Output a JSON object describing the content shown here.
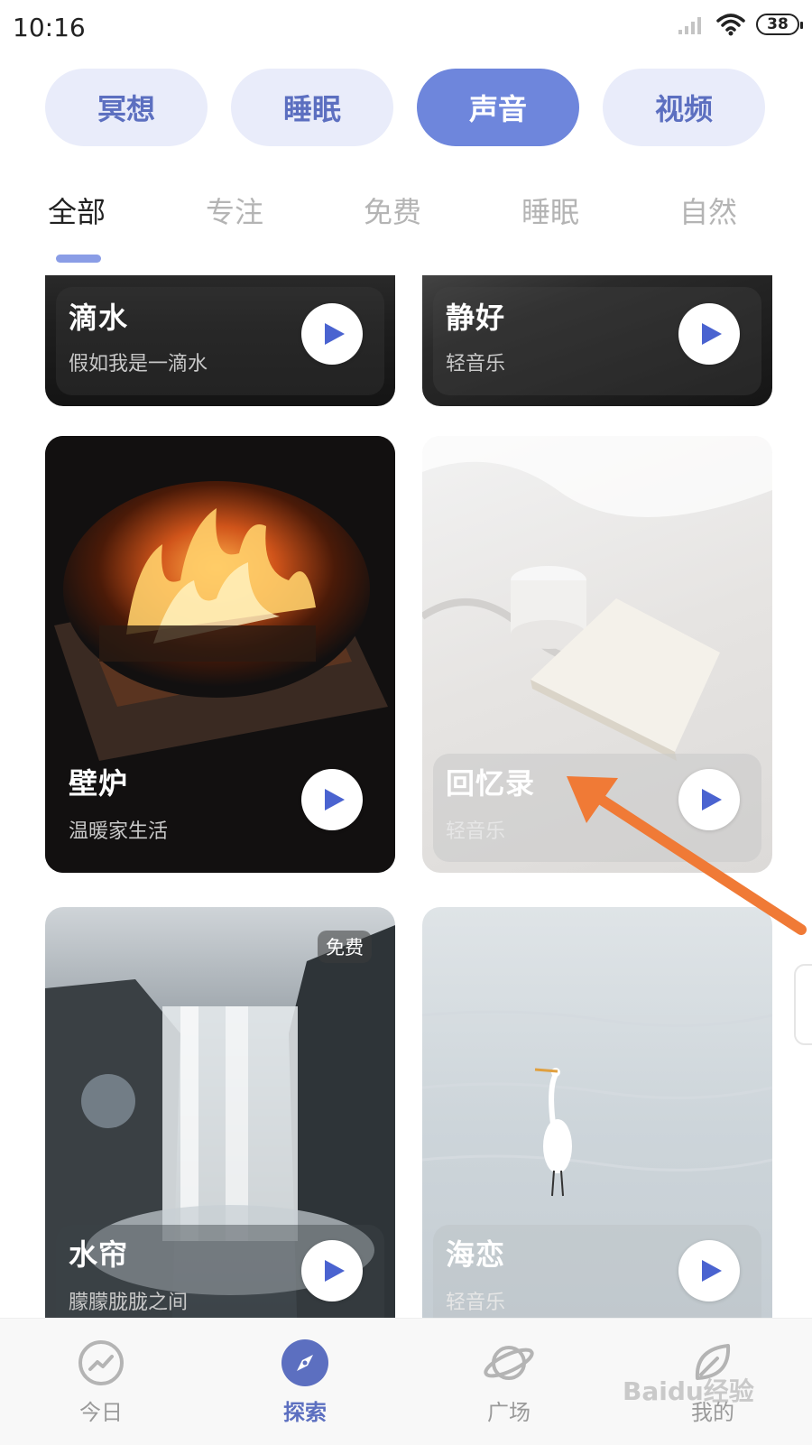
{
  "status_bar": {
    "time": "10:16",
    "battery": "38"
  },
  "top_tabs": [
    {
      "label": "冥想",
      "active": false
    },
    {
      "label": "睡眠",
      "active": false
    },
    {
      "label": "声音",
      "active": true
    },
    {
      "label": "视频",
      "active": false
    }
  ],
  "sub_tabs": [
    {
      "label": "全部",
      "active": true
    },
    {
      "label": "专注",
      "active": false
    },
    {
      "label": "免费",
      "active": false
    },
    {
      "label": "睡眠",
      "active": false
    },
    {
      "label": "自然",
      "active": false
    }
  ],
  "cards": [
    {
      "title": "滴水",
      "subtitle": "假如我是一滴水"
    },
    {
      "title": "静好",
      "subtitle": "轻音乐"
    },
    {
      "title": "壁炉",
      "subtitle": "温暖家生活"
    },
    {
      "title": "回忆录",
      "subtitle": "轻音乐"
    },
    {
      "title": "水帘",
      "subtitle": "朦朦胧胧之间",
      "badge": "免费"
    },
    {
      "title": "海恋",
      "subtitle": "轻音乐"
    }
  ],
  "bottom_nav": [
    {
      "label": "今日",
      "icon": "trend-icon",
      "active": false
    },
    {
      "label": "探索",
      "icon": "compass-icon",
      "active": true
    },
    {
      "label": "广场",
      "icon": "planet-icon",
      "active": false
    },
    {
      "label": "我的",
      "icon": "leaf-icon",
      "active": false
    }
  ],
  "watermark": "Baidu经验",
  "colors": {
    "accent": "#6e86dc",
    "pill_bg": "#e9ecfa",
    "pill_text": "#5c6fc0",
    "play_icon": "#4a63d0",
    "arrow": "#f07a36"
  }
}
